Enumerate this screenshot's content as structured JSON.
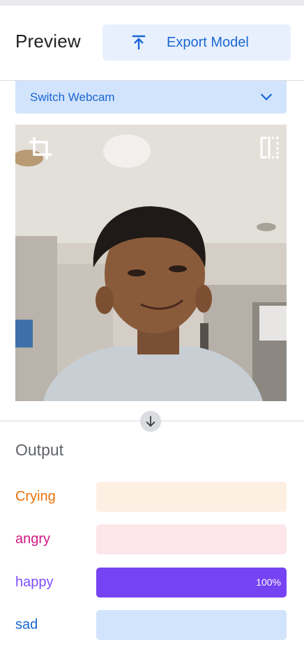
{
  "header": {
    "title": "Preview",
    "export_label": "Export Model"
  },
  "webcam": {
    "select_label": "Switch Webcam"
  },
  "output": {
    "title": "Output",
    "classes": [
      {
        "label": "Crying",
        "confidence": 0,
        "display": "",
        "label_color": "#e8710a",
        "track_color": "#feefe3",
        "fill_color": "#e8710a"
      },
      {
        "label": "angry",
        "confidence": 0,
        "display": "",
        "label_color": "#d01884",
        "track_color": "#fde7ea",
        "fill_color": "#d01884"
      },
      {
        "label": "happy",
        "confidence": 1.0,
        "display": "100%",
        "label_color": "#7c4dff",
        "track_color": "#ede7fe",
        "fill_color": "#7643f2"
      },
      {
        "label": "sad",
        "confidence": 0,
        "display": "",
        "label_color": "#1967d2",
        "track_color": "#d2e3fc",
        "fill_color": "#1967d2"
      }
    ]
  }
}
